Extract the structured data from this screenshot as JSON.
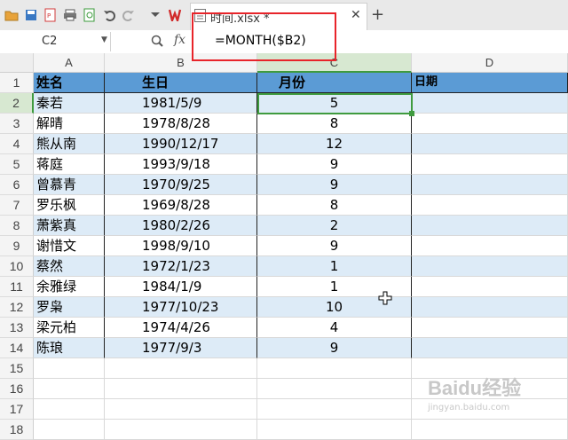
{
  "tab": {
    "filename": "时间.xlsx *"
  },
  "formula_bar": {
    "cell_ref": "C2",
    "fx_label": "fx",
    "formula": "=MONTH($B2)"
  },
  "columns": [
    "A",
    "B",
    "C",
    "D"
  ],
  "row_numbers": [
    "1",
    "2",
    "3",
    "4",
    "5",
    "6",
    "7",
    "8",
    "9",
    "10",
    "11",
    "12",
    "13",
    "14",
    "15",
    "16",
    "17",
    "18"
  ],
  "headers": [
    "姓名",
    "生日",
    "月份",
    "日期"
  ],
  "rows": [
    [
      "秦若",
      "1981/5/9",
      "5"
    ],
    [
      "解晴",
      "1978/8/28",
      "8"
    ],
    [
      "熊从南",
      "1990/12/17",
      "12"
    ],
    [
      "蒋庭",
      "1993/9/18",
      "9"
    ],
    [
      "曾慕青",
      "1970/9/25",
      "9"
    ],
    [
      "罗乐枫",
      "1969/8/28",
      "8"
    ],
    [
      "萧紫真",
      "1980/2/26",
      "2"
    ],
    [
      "谢惜文",
      "1998/9/10",
      "9"
    ],
    [
      "蔡然",
      "1972/1/23",
      "1"
    ],
    [
      "余雅绿",
      "1984/1/9",
      "1"
    ],
    [
      "罗枭",
      "1977/10/23",
      "10"
    ],
    [
      "梁元柏",
      "1974/4/26",
      "4"
    ],
    [
      "陈琅",
      "1977/9/3",
      "9"
    ]
  ],
  "selected_cell": "C2",
  "colors": {
    "header_fill": "#5b9bd5",
    "band_fill": "#ddebf7",
    "selection": "#3f9b3f",
    "highlight_box": "#e8242a"
  },
  "watermark": {
    "text": "Baidu经验",
    "sub": "jingyan.baidu.com"
  }
}
